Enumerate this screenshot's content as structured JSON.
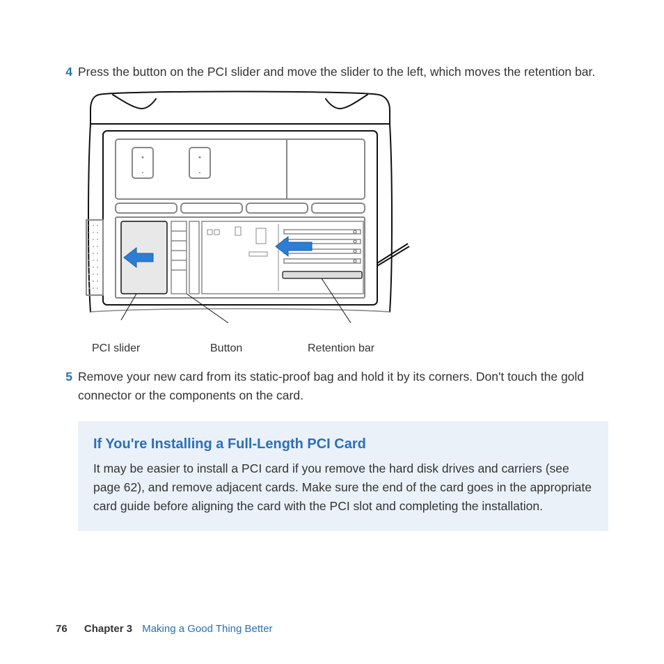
{
  "steps": {
    "s4": {
      "num": "4",
      "text": "Press the button on the PCI slider and move the slider to the left, which moves the retention bar."
    },
    "s5": {
      "num": "5",
      "text": "Remove your new card from its static-proof bag and hold it by its corners. Don't touch the gold connector or the components on the card."
    }
  },
  "diagram_labels": {
    "pci_slider": "PCI slider",
    "button": "Button",
    "retention_bar": "Retention bar"
  },
  "note": {
    "title": "If You're Installing a Full-Length PCI Card",
    "body": "It may be easier to install a PCI card if you remove the hard disk drives and carriers (see page 62), and remove adjacent cards. Make sure the end of the card goes in the appropriate card guide before aligning the card with the PCI slot and completing the installation."
  },
  "footer": {
    "page": "76",
    "chapter_label": "Chapter 3",
    "chapter_title": "Making a Good Thing Better"
  }
}
